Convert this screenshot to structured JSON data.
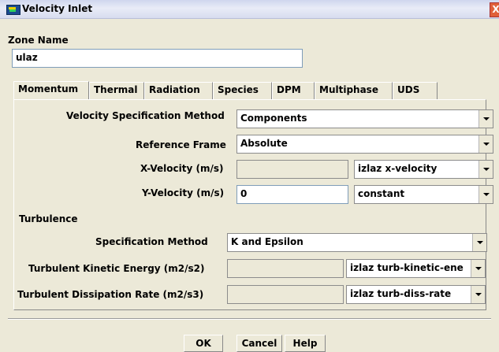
{
  "window": {
    "title": "Velocity Inlet",
    "close_label": "X"
  },
  "zone": {
    "label": "Zone Name",
    "value": "ulaz"
  },
  "tabs": [
    {
      "label": "Momentum"
    },
    {
      "label": "Thermal"
    },
    {
      "label": "Radiation"
    },
    {
      "label": "Species"
    },
    {
      "label": "DPM"
    },
    {
      "label": "Multiphase"
    },
    {
      "label": "UDS"
    }
  ],
  "momentum": {
    "method_label": "Velocity Specification Method",
    "method_value": "Components",
    "frame_label": "Reference Frame",
    "frame_value": "Absolute",
    "xvel_label": "X-Velocity (m/s)",
    "xvel_value": "",
    "xvel_profile": "izlaz x-velocity",
    "yvel_label": "Y-Velocity (m/s)",
    "yvel_value": "0",
    "yvel_profile": "constant"
  },
  "turbulence": {
    "heading": "Turbulence",
    "spec_label": "Specification Method",
    "spec_value": "K and Epsilon",
    "tke_label": "Turbulent Kinetic Energy (m2/s2)",
    "tke_value": "",
    "tke_profile": "izlaz turb-kinetic-ene",
    "tdr_label": "Turbulent Dissipation Rate (m2/s3)",
    "tdr_value": "",
    "tdr_profile": "izlaz turb-diss-rate"
  },
  "buttons": {
    "ok": "OK",
    "cancel": "Cancel",
    "help": "Help"
  }
}
